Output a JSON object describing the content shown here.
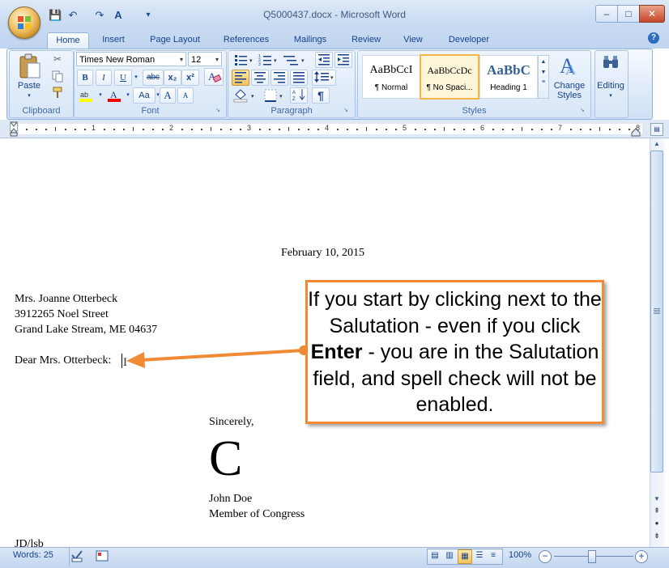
{
  "window": {
    "title": "Q5000437.docx - Microsoft Word",
    "minimize": "–",
    "maximize": "□",
    "close": "✕"
  },
  "quick_access": {
    "save": "💾",
    "undo": "↶",
    "redo": "↷",
    "format": "A",
    "customize": "▾"
  },
  "tabs": [
    "Home",
    "Insert",
    "Page Layout",
    "References",
    "Mailings",
    "Review",
    "View",
    "Developer"
  ],
  "help": "?",
  "clipboard": {
    "paste": "Paste",
    "group": "Clipboard"
  },
  "font": {
    "name": "Times New Roman",
    "size": "12",
    "group": "Font",
    "bold": "B",
    "italic": "I",
    "underline": "U",
    "strike": "abc",
    "subscript": "x₂",
    "superscript": "x²",
    "grow": "A",
    "shrink": "A",
    "case": "Aa",
    "clear": "A"
  },
  "paragraph": {
    "group": "Paragraph",
    "show_marks": "¶"
  },
  "styles": {
    "group": "Styles",
    "items": [
      {
        "preview": "AaBbCcI",
        "name": "¶ Normal"
      },
      {
        "preview": "AaBbCcDc",
        "name": "¶ No Spaci..."
      },
      {
        "preview": "AaBbC",
        "name": "Heading 1"
      }
    ],
    "change_styles": "Change Styles"
  },
  "editing": {
    "label": "Editing"
  },
  "ruler_numbers": [
    "1",
    "2",
    "3",
    "4",
    "5",
    "6",
    "7",
    "8"
  ],
  "document": {
    "date": "February 10, 2015",
    "address": [
      "Mrs. Joanne Otterbeck",
      "3912265 Noel Street",
      "Grand Lake Stream, ME  04637"
    ],
    "salutation": "Dear Mrs. Otterbeck:",
    "closing": "Sincerely,",
    "signature": "C",
    "signer_name": "John Doe",
    "signer_title": "Member of Congress",
    "initials": "JD/lsb"
  },
  "callout": {
    "pre": "If you start by clicking next to the Salutation - even if you click ",
    "bold": "Enter",
    "post": " - you are in the Salutation field, and spell check will not be enabled."
  },
  "status": {
    "words": "Words: 25",
    "zoom": "100%"
  },
  "colors": {
    "callout_border": "#f08a35",
    "ribbon": "#dfeaf8",
    "status": "#c3d6ef"
  }
}
